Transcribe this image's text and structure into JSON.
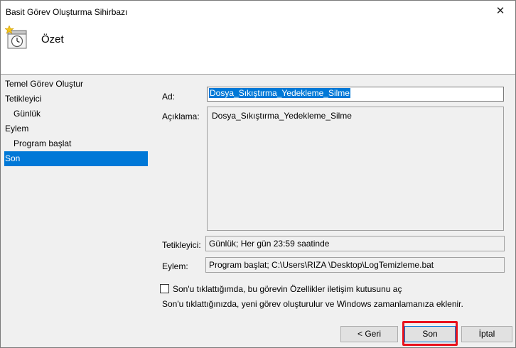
{
  "window": {
    "title": "Basit Görev Oluşturma Sihirbazı",
    "close_glyph": "✕"
  },
  "header": {
    "title": "Özet",
    "icon": "task-clock-icon"
  },
  "nav": {
    "items": [
      {
        "label": "Temel Görev Oluştur",
        "sub": false,
        "selected": false
      },
      {
        "label": "Tetikleyici",
        "sub": false,
        "selected": false
      },
      {
        "label": "Günlük",
        "sub": true,
        "selected": false
      },
      {
        "label": "Eylem",
        "sub": false,
        "selected": false
      },
      {
        "label": "Program başlat",
        "sub": true,
        "selected": false
      },
      {
        "label": "Son",
        "sub": false,
        "selected": true
      }
    ]
  },
  "summary": {
    "name_label": "Ad:",
    "name_value": "Dosya_Sıkıştırma_Yedekleme_Silme",
    "description_label": "Açıklama:",
    "description_value": "Dosya_Sıkıştırma_Yedekleme_Silme",
    "trigger_label": "Tetikleyici:",
    "trigger_value": "Günlük; Her gün 23:59 saatinde",
    "action_label": "Eylem:",
    "action_value": "Program başlat; C:\\Users\\RIZA  \\Desktop\\LogTemizleme.bat"
  },
  "options": {
    "checkbox_label": "Son'u tıklattığımda, bu görevin Özellikler iletişim kutusunu aç",
    "checkbox_checked": false,
    "note": "Son'u tıklattığınızda, yeni görev oluşturulur ve Windows zamanlamanıza eklenir."
  },
  "buttons": {
    "back": "< Geri",
    "finish": "Son",
    "cancel": "İptal"
  },
  "colors": {
    "selection": "#0078d7",
    "highlight": "#e8121d"
  }
}
